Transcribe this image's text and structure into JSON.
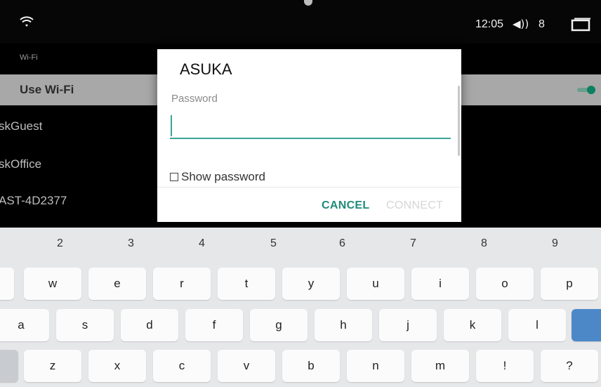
{
  "status_bar": {
    "time": "12:05",
    "volume_icon": "volume-icon",
    "volume_level": "8",
    "wifi_icon": "wifi-icon",
    "recent_apps_icon": "recent-apps-icon"
  },
  "settings": {
    "section_header": "Wi-Fi",
    "use_wifi_label": "Use Wi-Fi",
    "use_wifi_on": true,
    "networks": [
      "skGuest",
      "skOffice",
      "AST-4D2377"
    ]
  },
  "dialog": {
    "title": "ASUKA",
    "password_label": "Password",
    "password_value": "",
    "show_password_label": "Show password",
    "cancel_label": "CANCEL",
    "connect_label": "CONNECT",
    "accent_color": "#1f8a7a"
  },
  "keyboard": {
    "number_row": [
      "2",
      "3",
      "4",
      "5",
      "6",
      "7",
      "8",
      "9"
    ],
    "row1": [
      "w",
      "e",
      "r",
      "t",
      "y",
      "u",
      "i",
      "o",
      "p"
    ],
    "row2": [
      "a",
      "s",
      "d",
      "f",
      "g",
      "h",
      "j",
      "k",
      "l"
    ],
    "row3": [
      "z",
      "x",
      "c",
      "v",
      "b",
      "n",
      "m",
      "!",
      "?"
    ]
  }
}
